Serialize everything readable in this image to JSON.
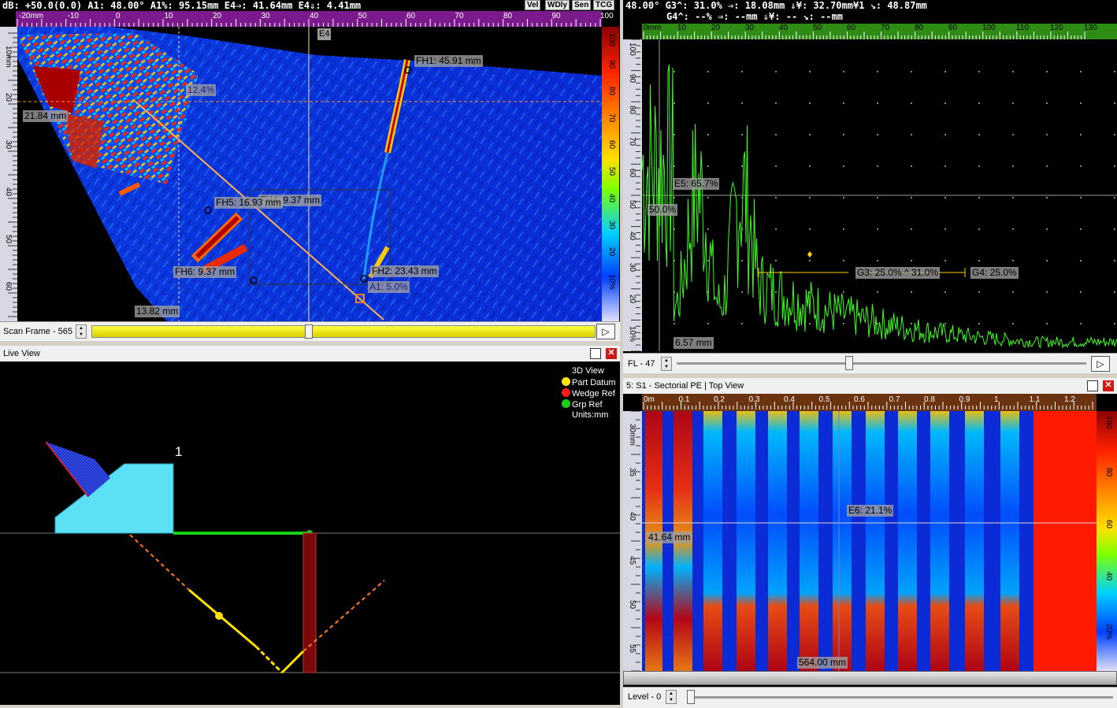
{
  "sscan": {
    "status": "dB: +50.0(0.0)   A1: 48.00°  A1%: 95.15mm  E4⇒: 41.64mm  E4⇓: 4.41mm",
    "buttons": [
      "Vel",
      "WDly",
      "Sen",
      "TCG"
    ],
    "top_ticks": [
      "-20mm",
      "-10",
      "0",
      "10",
      "20",
      "30",
      "40",
      "50",
      "60",
      "70",
      "80",
      "90",
      "100"
    ],
    "left_ticks": [
      "10mm",
      "20",
      "30",
      "40",
      "50",
      "60"
    ],
    "right_ticks": [
      "100",
      "90",
      "80",
      "70",
      "60",
      "50",
      "40",
      "30",
      "20",
      "10%"
    ],
    "cursor_label": "E4",
    "tags": {
      "fh1": "FH1: 45.91 mm",
      "pct": "12.4%",
      "depth": "21.84 mm",
      "fh4": "FH4: 9.37 mm",
      "fh5": "FH5: 16.93 mm",
      "fh6": "FH6: 9.37 mm",
      "fh2": "FH2: 23.43 mm",
      "a1": "A1: 5.0%",
      "bottom": "13.82 mm"
    },
    "slider_label": "Scan Frame - 565",
    "play": "▷"
  },
  "ascan": {
    "status_line1": "48.00°  G3^: 31.0%    ⇒: 18.08mm  ⇓¥: 32.70mm¥1  ↘: 48.87mm",
    "status_line2": "G4^: --%    ⇒: --mm     ⇓¥: --        ↘: --mm",
    "top_ticks": [
      "0mm",
      "10",
      "20",
      "30",
      "40",
      "50",
      "60",
      "70",
      "80",
      "90",
      "100",
      "110",
      "120",
      "130"
    ],
    "left_ticks": [
      "100",
      "90",
      "80",
      "70",
      "60",
      "50",
      "40",
      "30",
      "20",
      "10%"
    ],
    "tags": {
      "e5": "E5: 65.7%",
      "fifty": "50.0%",
      "g3": "G3: 25.0% ^ 31.0%",
      "g4": "G4: 25.0%",
      "bottom": "6.57 mm"
    },
    "slider_label": "FL - 47",
    "play": "▷"
  },
  "live": {
    "title": "Live View",
    "legend_title": "3D View",
    "legend": [
      {
        "label": "Part Datum",
        "color": "#ffe600"
      },
      {
        "label": "Wedge Ref",
        "color": "#ff1a1a"
      },
      {
        "label": "Grp Ref",
        "color": "#17d117"
      }
    ],
    "units": "Units:mm",
    "probe_number": "1"
  },
  "cscan": {
    "title": "5: S1 - Sectorial PE | Top View",
    "top_ticks": [
      "0m",
      "0.1",
      "0.2",
      "0.3",
      "0.4",
      "0.5",
      "0.6",
      "0.7",
      "0.8",
      "0.9",
      "1",
      "1.1",
      "1.2"
    ],
    "left_ticks": [
      "30mm",
      "35",
      "40",
      "45",
      "50",
      "55"
    ],
    "right_ticks": [
      "100",
      "80",
      "60",
      "40",
      "20%"
    ],
    "tags": {
      "e6": "E6: 21.1%",
      "depth": "41.64 mm",
      "bottom": "564.00 mm"
    },
    "slider_label": "Level - 0"
  },
  "colors": {
    "deep_blue": "#0a2bd6",
    "ruler_purple": "#7a1a8c",
    "ruler_green": "#2e8b14",
    "ruler_brown": "#6b3310",
    "signal": "#3cff1c"
  }
}
